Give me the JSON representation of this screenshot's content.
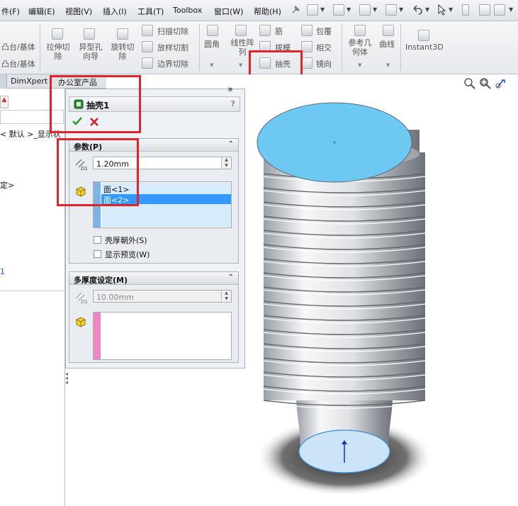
{
  "menubar": {
    "items": [
      "件(F)",
      "编辑(E)",
      "视图(V)",
      "插入(I)",
      "工具(T)",
      "Toolbox",
      "窗口(W)",
      "帮助(H)"
    ]
  },
  "ribbon": {
    "boss_base_1": "凸台/基体",
    "boss_base_2": "凸台/基体",
    "extruded_cut": "拉伸切除",
    "hole_wizard": "异型孔向导",
    "revolved_cut": "旋转切除",
    "swept_cut": "扫描切除",
    "lofted_cut": "放样切割",
    "boundary_cut": "边界切除",
    "fillet": "圆角",
    "linear_pattern": "线性阵列",
    "rib": "筋",
    "draft": "拔模",
    "shell": "抽壳",
    "wrap": "包覆",
    "intersect": "相交",
    "mirror": "镜向",
    "reference_geometry": "参考几何体",
    "curves": "曲线",
    "instant3d": "Instant3D"
  },
  "tabs": {
    "dimxpert": "DimXpert",
    "office": "办公室产品",
    "more": "»"
  },
  "tree": {
    "line1": "< 默认 >_显示状",
    "line2": "定>",
    "line3": "1"
  },
  "property_manager": {
    "title": "抽壳1",
    "help": "?",
    "parameters": {
      "title": "参数(P)",
      "thickness": "1.20mm",
      "faces": [
        "面<1>",
        "面<2>"
      ],
      "shell_outward": "壳厚朝外(S)",
      "show_preview": "显示预览(W)"
    },
    "multi_thickness": {
      "title": "多厚度设定(M)",
      "thickness": "10.00mm"
    }
  },
  "colors": {
    "highlight": "#e0242b",
    "face_select": "#6dc8f2",
    "list_select": "#3399ff"
  }
}
